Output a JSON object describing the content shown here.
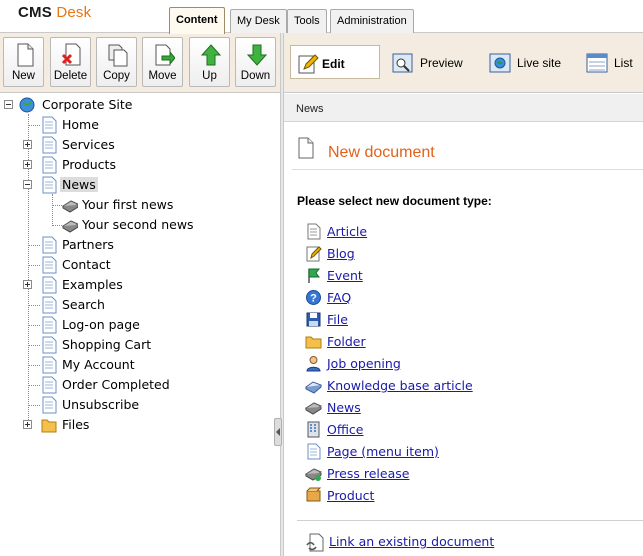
{
  "logo": {
    "part1": "CMS",
    "part2": "Desk"
  },
  "tabs": [
    {
      "label": "Content",
      "active": true
    },
    {
      "label": "My Desk",
      "active": false
    },
    {
      "label": "Tools",
      "active": false
    },
    {
      "label": "Administration",
      "active": false
    }
  ],
  "toolbar": {
    "new_label": "New",
    "delete_label": "Delete",
    "copy_label": "Copy",
    "move_label": "Move",
    "up_label": "Up",
    "down_label": "Down"
  },
  "view_modes": {
    "edit_label": "Edit",
    "preview_label": "Preview",
    "live_site_label": "Live site",
    "list_label": "List",
    "active": "Edit"
  },
  "tree": {
    "root": "Corporate Site",
    "items": [
      {
        "label": "Home"
      },
      {
        "label": "Services",
        "expandable": true
      },
      {
        "label": "Products",
        "expandable": true
      },
      {
        "label": "News",
        "expanded": true,
        "selected": true,
        "children": [
          "Your first news",
          "Your second news"
        ]
      },
      {
        "label": "Partners"
      },
      {
        "label": "Contact"
      },
      {
        "label": "Examples",
        "expandable": true
      },
      {
        "label": "Search"
      },
      {
        "label": "Log-on page"
      },
      {
        "label": "Shopping Cart"
      },
      {
        "label": "My Account"
      },
      {
        "label": "Order Completed"
      },
      {
        "label": "Unsubscribe"
      },
      {
        "label": "Files",
        "expandable": true
      }
    ]
  },
  "breadcrumb": "News",
  "page_title": "New document",
  "instruction": "Please select new document type:",
  "document_types": [
    {
      "label": "Article",
      "icon": "article-icon"
    },
    {
      "label": "Blog",
      "icon": "blog-icon"
    },
    {
      "label": "Event",
      "icon": "event-icon"
    },
    {
      "label": "FAQ",
      "icon": "faq-icon"
    },
    {
      "label": "File",
      "icon": "file-icon"
    },
    {
      "label": "Folder",
      "icon": "folder-icon"
    },
    {
      "label": "Job opening",
      "icon": "job-opening-icon"
    },
    {
      "label": "Knowledge base article",
      "icon": "knowledge-base-icon"
    },
    {
      "label": "News",
      "icon": "news-icon"
    },
    {
      "label": "Office",
      "icon": "office-icon"
    },
    {
      "label": "Page (menu item)",
      "icon": "page-icon"
    },
    {
      "label": "Press release",
      "icon": "press-release-icon"
    },
    {
      "label": "Product",
      "icon": "product-icon"
    }
  ],
  "link_existing": "Link an existing document",
  "colors": {
    "accent": "#e87511",
    "title": "#e0621b",
    "link": "#1a1aa8",
    "toolbar_bg": "#f4ece0"
  }
}
